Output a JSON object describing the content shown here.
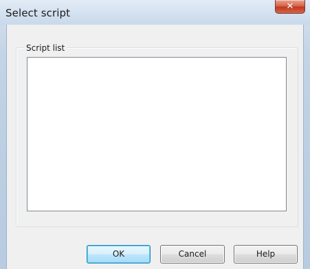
{
  "window": {
    "title": "Select script",
    "close_symbol": "✕"
  },
  "group": {
    "label": "Script list"
  },
  "script_list": {
    "items": []
  },
  "buttons": {
    "ok_label": "OK",
    "cancel_label": "Cancel",
    "help_label": "Help"
  },
  "colors": {
    "close_button": "#c1381c",
    "default_button_border": "#3c7fb1"
  }
}
